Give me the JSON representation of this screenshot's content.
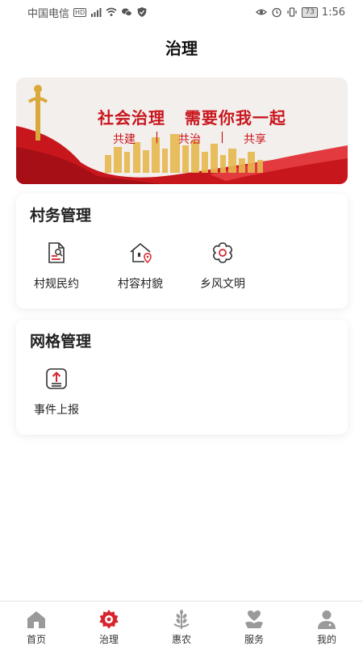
{
  "status_bar": {
    "carrier": "中国电信",
    "hd": "HD",
    "signal": "⁴ᴳ",
    "battery": "73",
    "time": "1:56"
  },
  "header": {
    "title": "治理"
  },
  "banner": {
    "title": "社会治理   需要你我一起",
    "subtitles": [
      "共建",
      "共治",
      "共享"
    ],
    "separator": "|"
  },
  "sections": [
    {
      "title": "村务管理",
      "items": [
        {
          "label": "村规民约",
          "icon": "document-edit-icon"
        },
        {
          "label": "村容村貌",
          "icon": "house-pin-icon"
        },
        {
          "label": "乡风文明",
          "icon": "flower-icon"
        }
      ]
    },
    {
      "title": "网格管理",
      "items": [
        {
          "label": "事件上报",
          "icon": "upload-report-icon"
        }
      ]
    }
  ],
  "tabbar": {
    "active": "治理",
    "active_color": "#d8252d",
    "inactive_color": "#9a9a9a",
    "items": [
      {
        "label": "首页",
        "icon": "home-icon"
      },
      {
        "label": "治理",
        "icon": "gear-icon"
      },
      {
        "label": "惠农",
        "icon": "wheat-icon"
      },
      {
        "label": "服务",
        "icon": "heart-hand-icon"
      },
      {
        "label": "我的",
        "icon": "user-icon"
      }
    ]
  }
}
